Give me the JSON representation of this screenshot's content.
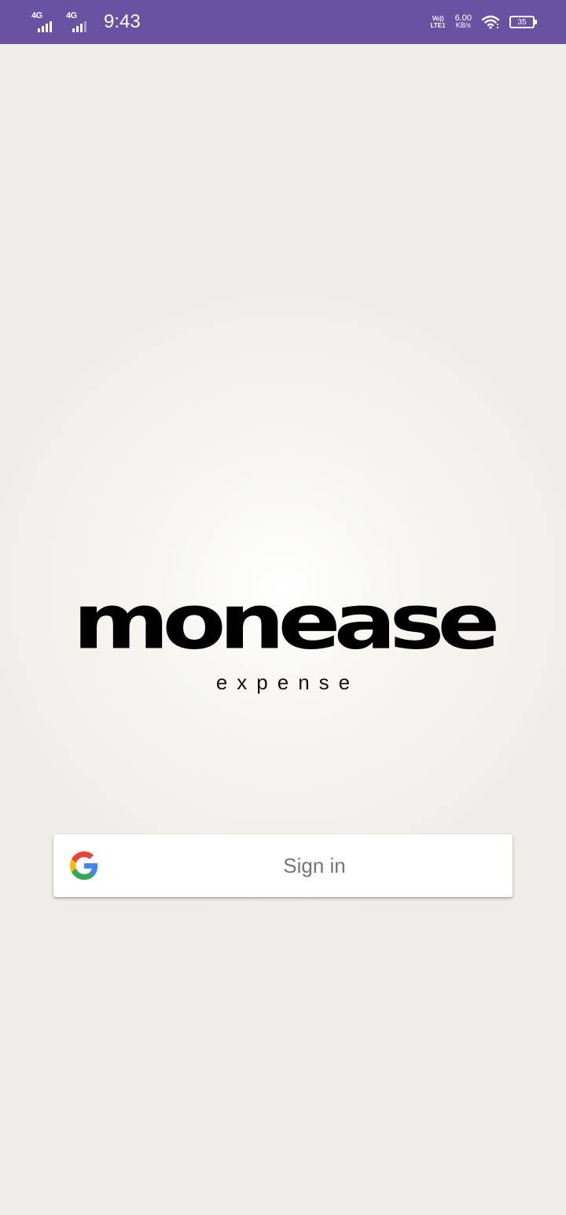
{
  "status_bar": {
    "sim1_label": "4G",
    "sim2_label": "4G",
    "time": "9:43",
    "volte_line1": "Vo))",
    "volte_line2": "LTE1",
    "speed_value": "6.00",
    "speed_unit": "KB/s",
    "battery": "35",
    "background": "#6a52a3"
  },
  "logo": {
    "title": "monease",
    "subtitle": "expense"
  },
  "sign_in": {
    "label": "Sign in",
    "icon": "google-g-icon"
  },
  "colors": {
    "background": "#efede7",
    "button_text": "#757575"
  }
}
